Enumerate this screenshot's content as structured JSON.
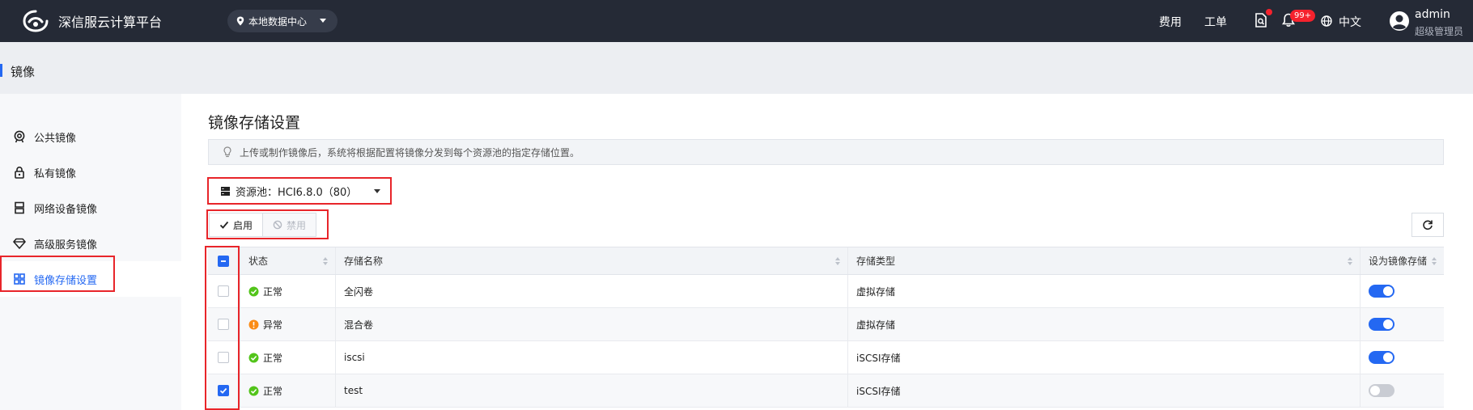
{
  "header": {
    "brand": "深信服云计算平台",
    "datacenter": "本地数据中心",
    "links": [
      "费用",
      "工单"
    ],
    "notification_badge": "99+",
    "language": "中文",
    "user": {
      "name": "admin",
      "role": "超级管理员"
    }
  },
  "breadcrumb": {
    "title": "镜像"
  },
  "sidebar": {
    "items": [
      {
        "label": "公共镜像",
        "icon": "public-image-icon"
      },
      {
        "label": "私有镜像",
        "icon": "lock-icon"
      },
      {
        "label": "网络设备镜像",
        "icon": "server-icon"
      },
      {
        "label": "高级服务镜像",
        "icon": "diamond-icon"
      },
      {
        "label": "镜像存储设置",
        "icon": "grid-icon",
        "active": true
      }
    ]
  },
  "main": {
    "title": "镜像存储设置",
    "notice": "上传或制作镜像后，系统将根据配置将镜像分发到每个资源池的指定存储位置。",
    "pool_select": "资源池：HCI6.8.0（80）",
    "enable_label": "启用",
    "disable_label": "禁用"
  },
  "table": {
    "columns": {
      "status": "状态",
      "name": "存储名称",
      "type": "存储类型",
      "image_storage": "设为镜像存储"
    },
    "rows": [
      {
        "checked": false,
        "status": "正常",
        "status_kind": "ok",
        "name": "全闪卷",
        "type": "虚拟存储",
        "enabled": true
      },
      {
        "checked": false,
        "status": "异常",
        "status_kind": "warn",
        "name": "混合卷",
        "type": "虚拟存储",
        "enabled": true
      },
      {
        "checked": false,
        "status": "正常",
        "status_kind": "ok",
        "name": "iscsi",
        "type": "iSCSI存储",
        "enabled": true
      },
      {
        "checked": true,
        "status": "正常",
        "status_kind": "ok",
        "name": "test",
        "type": "iSCSI存储",
        "enabled": false
      }
    ]
  },
  "colors": {
    "accent": "#2468f2",
    "topbar": "#252a36",
    "ok": "#52c41a",
    "warn": "#fa8c16",
    "highlight": "#e8252a"
  }
}
